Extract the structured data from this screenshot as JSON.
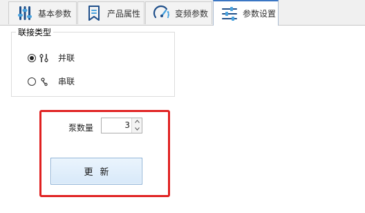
{
  "tabs": [
    {
      "label": "基本参数",
      "icon": "sliders-vertical-icon",
      "active": false
    },
    {
      "label": "产品属性",
      "icon": "bookmark-icon",
      "active": false
    },
    {
      "label": "变频参数",
      "icon": "gauge-icon",
      "active": false
    },
    {
      "label": "参数设置",
      "icon": "sliders-horizontal-icon",
      "active": true
    }
  ],
  "connection": {
    "group_title": "联接类型",
    "options": [
      {
        "label": "并联",
        "icon": "parallel-connection-icon",
        "selected": true
      },
      {
        "label": "串联",
        "icon": "series-connection-icon",
        "selected": false
      }
    ]
  },
  "pump": {
    "count_label": "泵数量",
    "count_value": "3"
  },
  "update_button_label": "更新",
  "colors": {
    "accent_blue": "#3a76c4",
    "highlight_red": "#e02020"
  }
}
